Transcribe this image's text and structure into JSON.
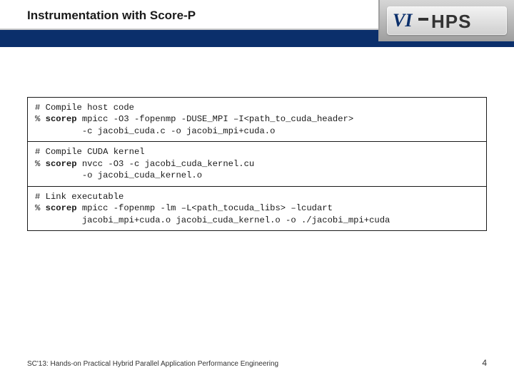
{
  "header": {
    "title": "Instrumentation with Score-P",
    "logo_text_vi": "VI",
    "logo_text_hps": "HPS"
  },
  "code": {
    "block1": {
      "comment": "# Compile host code",
      "prompt": "% ",
      "cmd1_a": "scorep",
      "cmd1_b": " mpicc -O3 -fopenmp -DUSE_MPI –I<path_to_cuda_header>",
      "cmd2": "         -c jacobi_cuda.c -o jacobi_mpi+cuda.o"
    },
    "block2": {
      "comment": "# Compile CUDA kernel",
      "prompt": "% ",
      "cmd1_a": "scorep",
      "cmd1_b": " nvcc -O3 -c jacobi_cuda_kernel.cu",
      "cmd2": "         -o jacobi_cuda_kernel.o"
    },
    "block3": {
      "comment": "# Link executable",
      "prompt": "% ",
      "cmd1_a": "scorep",
      "cmd1_b": " mpicc -fopenmp -lm –L<path_tocuda_libs> –lcudart",
      "cmd2": "         jacobi_mpi+cuda.o jacobi_cuda_kernel.o -o ./jacobi_mpi+cuda"
    }
  },
  "footer": {
    "left": "SC'13: Hands-on Practical Hybrid Parallel Application Performance Engineering",
    "page": "4"
  }
}
